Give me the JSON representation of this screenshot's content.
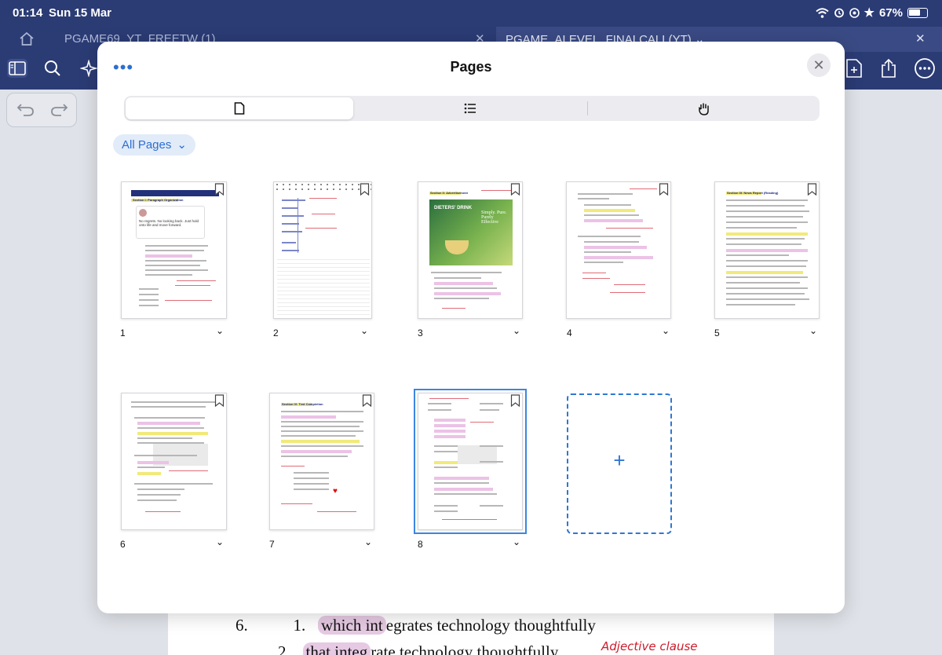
{
  "status": {
    "time": "01:14",
    "date": "Sun 15 Mar",
    "battery": "67%",
    "battery_level": 0.67
  },
  "tabs": [
    {
      "label": "PGAME69_YT_FREETW (1)",
      "active": false
    },
    {
      "label": "PGAME_ALEVEL_FINALCALL(YT)",
      "active": true
    }
  ],
  "modal": {
    "title": "Pages",
    "more_icon": "•••",
    "close_icon": "✕",
    "segments": [
      "pages-icon",
      "outline-icon",
      "hand-icon"
    ],
    "filter_label": "All Pages",
    "add_page_icon": "+"
  },
  "pages": [
    {
      "number": "1",
      "heading": "Section I: Paragraph Organization",
      "quote": "No regrets. No looking back. Just hold onto life and move forward."
    },
    {
      "number": "2"
    },
    {
      "number": "3",
      "heading": "Section II: Advertisement",
      "ad_text": "DIETERS' DRINK",
      "ad_tagline": "Simply. Pure. Purely Effective"
    },
    {
      "number": "4"
    },
    {
      "number": "5",
      "heading": "Section III: News Report (Reading)"
    },
    {
      "number": "6"
    },
    {
      "number": "7",
      "heading": "Section IV: Text Completion"
    },
    {
      "number": "8",
      "selected": true
    }
  ],
  "background_doc": {
    "line1_num": "6.",
    "line1_opt": "1.",
    "line1_hl": "which int",
    "line1_text": "egrates technology thoughtfully",
    "line2_opt": "2.",
    "line2_hl": "that integ",
    "line2_text": "rate technology thoughtfully",
    "annotation": "Adjective clause"
  }
}
